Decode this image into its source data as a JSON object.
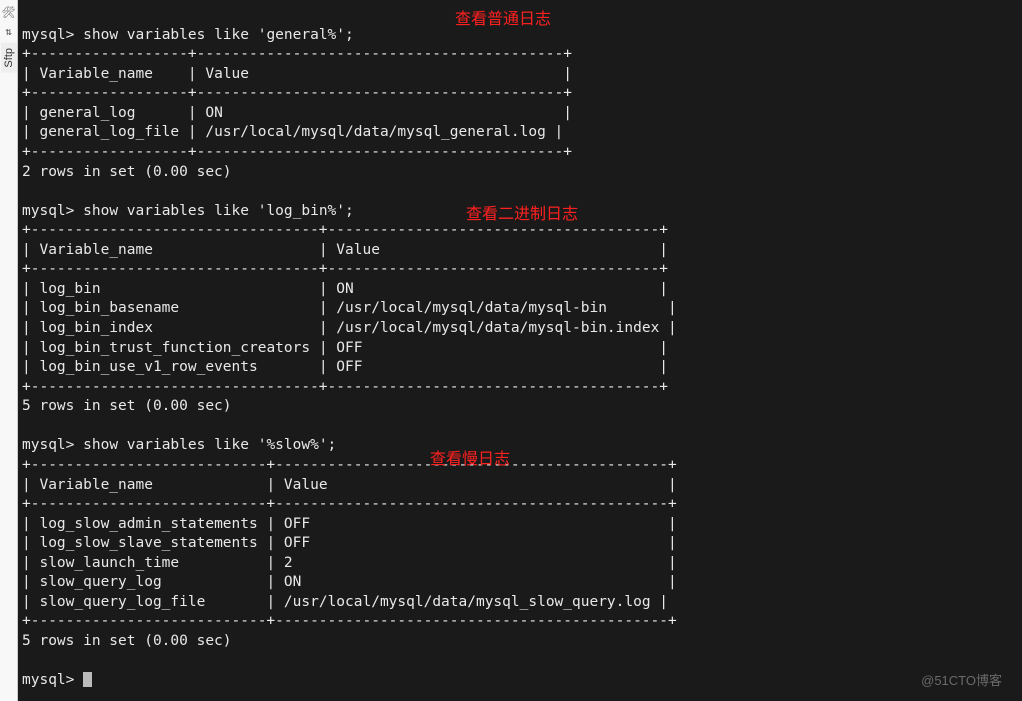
{
  "sidebar": {
    "tab_label": "Sftp"
  },
  "annotations": {
    "a1": "查看普通日志",
    "a2": "查看二进制日志",
    "a3": "查看慢日志"
  },
  "prompt": "mysql>",
  "watermark": "@51CTO博客",
  "cmd1": {
    "command": "show variables like 'general%';",
    "header_name": "Variable_name",
    "header_value": "Value",
    "rows": [
      {
        "name": "general_log",
        "value": "ON"
      },
      {
        "name": "general_log_file",
        "value": "/usr/local/mysql/data/mysql_general.log"
      }
    ],
    "footer": "2 rows in set (0.00 sec)"
  },
  "cmd2": {
    "command": "show variables like 'log_bin%';",
    "header_name": "Variable_name",
    "header_value": "Value",
    "rows": [
      {
        "name": "log_bin",
        "value": "ON"
      },
      {
        "name": "log_bin_basename",
        "value": "/usr/local/mysql/data/mysql-bin"
      },
      {
        "name": "log_bin_index",
        "value": "/usr/local/mysql/data/mysql-bin.index"
      },
      {
        "name": "log_bin_trust_function_creators",
        "value": "OFF"
      },
      {
        "name": "log_bin_use_v1_row_events",
        "value": "OFF"
      }
    ],
    "footer": "5 rows in set (0.00 sec)"
  },
  "cmd3": {
    "command": "show variables like '%slow%';",
    "header_name": "Variable_name",
    "header_value": "Value",
    "rows": [
      {
        "name": "log_slow_admin_statements",
        "value": "OFF"
      },
      {
        "name": "log_slow_slave_statements",
        "value": "OFF"
      },
      {
        "name": "slow_launch_time",
        "value": "2"
      },
      {
        "name": "slow_query_log",
        "value": "ON"
      },
      {
        "name": "slow_query_log_file",
        "value": "/usr/local/mysql/data/mysql_slow_query.log"
      }
    ],
    "footer": "5 rows in set (0.00 sec)"
  }
}
